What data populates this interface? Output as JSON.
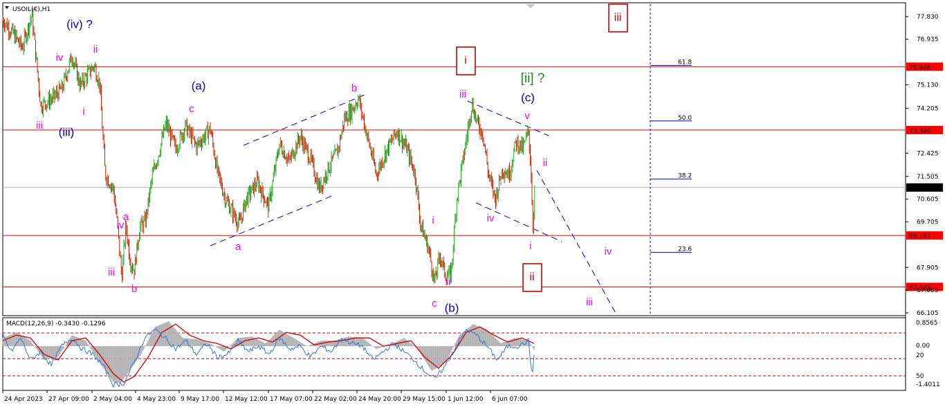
{
  "header": {
    "symbol_label": "USOIL(€),H1",
    "macd_label": "MACD(12,26,9) -0.3430 -0.1296"
  },
  "colors": {
    "bg": "#ffffff",
    "up_candle": "#22aa22",
    "down_candle": "#cc2200",
    "hline": "#ff0000",
    "fib": "#0000cc",
    "trend": "#0000cc",
    "wave_blue": "#0000cc",
    "wave_magenta": "#ff00ff",
    "wave_red": "#cc0000",
    "wave_green": "#228b22",
    "macd_hist": "#b0b0b0",
    "macd_signal": "#cc0000",
    "macd_line": "#1e6fd9"
  },
  "chart_data": {
    "type": "candlestick",
    "title": "USOIL(€),H1",
    "ylim": [
      66.105,
      78.0
    ],
    "y_ticks": [
      "77.830",
      "76.935",
      "75.130",
      "74.205",
      "72.425",
      "71.505",
      "70.605",
      "69.705",
      "67.905",
      "67.005",
      "66.105"
    ],
    "x_ticks": [
      "24 Apr 2023",
      "27 Apr 09:00",
      "2 May 04:00",
      "4 May 23:00",
      "9 May 17:00",
      "12 May 12:00",
      "17 May 07:00",
      "22 May 02:00",
      "24 May 20:00",
      "29 May 15:00",
      "1 Jun 12:00",
      "6 Jun 07:00"
    ],
    "price_levels": [
      {
        "value": 75.848,
        "label": "75.848"
      },
      {
        "value": 73.34,
        "label": "73.340"
      },
      {
        "value": 71.067,
        "label": "71.067"
      },
      {
        "value": 69.167,
        "label": "69.167"
      },
      {
        "value": 67.133,
        "label": "67.133"
      }
    ],
    "fib_levels": [
      {
        "label": "61.8",
        "value": 75.9
      },
      {
        "label": "50.0",
        "value": 73.7
      },
      {
        "label": "38.2",
        "value": 71.4
      },
      {
        "label": "23.6",
        "value": 68.5
      }
    ],
    "price_path": [
      [
        0,
        77.7
      ],
      [
        14,
        77.2
      ],
      [
        28,
        76.6
      ],
      [
        42,
        77.9
      ],
      [
        55,
        74.3
      ],
      [
        72,
        74.6
      ],
      [
        86,
        75.0
      ],
      [
        100,
        76.3
      ],
      [
        112,
        75.1
      ],
      [
        124,
        75.6
      ],
      [
        132,
        75.9
      ],
      [
        140,
        75.2
      ],
      [
        148,
        71.6
      ],
      [
        160,
        71.0
      ],
      [
        166,
        69.5
      ],
      [
        172,
        67.5
      ],
      [
        178,
        69.6
      ],
      [
        184,
        68.2
      ],
      [
        190,
        67.8
      ],
      [
        198,
        69.5
      ],
      [
        206,
        69.7
      ],
      [
        216,
        71.5
      ],
      [
        226,
        72.5
      ],
      [
        236,
        73.6
      ],
      [
        250,
        72.6
      ],
      [
        264,
        73.5
      ],
      [
        280,
        72.7
      ],
      [
        300,
        73.4
      ],
      [
        310,
        71.7
      ],
      [
        322,
        70.6
      ],
      [
        332,
        70.1
      ],
      [
        342,
        69.6
      ],
      [
        352,
        70.6
      ],
      [
        368,
        71.3
      ],
      [
        384,
        70.3
      ],
      [
        400,
        72.8
      ],
      [
        414,
        72.1
      ],
      [
        430,
        73.1
      ],
      [
        446,
        72.1
      ],
      [
        458,
        71.0
      ],
      [
        470,
        71.8
      ],
      [
        484,
        72.5
      ],
      [
        494,
        73.8
      ],
      [
        504,
        74.1
      ],
      [
        514,
        74.6
      ],
      [
        526,
        73.2
      ],
      [
        540,
        71.6
      ],
      [
        556,
        72.6
      ],
      [
        570,
        73.3
      ],
      [
        584,
        72.6
      ],
      [
        596,
        71.6
      ],
      [
        604,
        69.6
      ],
      [
        616,
        68.6
      ],
      [
        624,
        67.3
      ],
      [
        632,
        68.4
      ],
      [
        640,
        67.6
      ],
      [
        648,
        67.6
      ],
      [
        656,
        70.6
      ],
      [
        668,
        72.6
      ],
      [
        678,
        74.4
      ],
      [
        686,
        73.6
      ],
      [
        694,
        73.2
      ],
      [
        702,
        71.6
      ],
      [
        712,
        70.6
      ],
      [
        722,
        71.8
      ],
      [
        732,
        71.6
      ],
      [
        742,
        72.9
      ],
      [
        752,
        72.6
      ],
      [
        760,
        73.3
      ],
      [
        764,
        71.5
      ],
      [
        766,
        69.4
      ],
      [
        769,
        71.067
      ]
    ],
    "macd_histogram_path": [
      [
        0,
        0.3
      ],
      [
        20,
        0.5
      ],
      [
        40,
        0.2
      ],
      [
        60,
        -0.5
      ],
      [
        80,
        -0.4
      ],
      [
        100,
        0.4
      ],
      [
        120,
        0.2
      ],
      [
        140,
        -0.6
      ],
      [
        160,
        -1.3
      ],
      [
        170,
        -1.35
      ],
      [
        180,
        -1.0
      ],
      [
        200,
        -0.3
      ],
      [
        220,
        0.7
      ],
      [
        240,
        0.9
      ],
      [
        260,
        0.3
      ],
      [
        280,
        0.25
      ],
      [
        300,
        0.1
      ],
      [
        320,
        -0.2
      ],
      [
        340,
        0.3
      ],
      [
        360,
        0.35
      ],
      [
        380,
        0.1
      ],
      [
        400,
        0.6
      ],
      [
        420,
        0.3
      ],
      [
        440,
        0.0
      ],
      [
        460,
        0.2
      ],
      [
        480,
        0.2
      ],
      [
        500,
        0.35
      ],
      [
        520,
        0.3
      ],
      [
        540,
        -0.1
      ],
      [
        560,
        0.05
      ],
      [
        580,
        0.3
      ],
      [
        600,
        -0.1
      ],
      [
        620,
        -0.9
      ],
      [
        640,
        -0.6
      ],
      [
        660,
        0.4
      ],
      [
        680,
        0.8
      ],
      [
        700,
        0.6
      ],
      [
        720,
        0.1
      ],
      [
        740,
        0.3
      ],
      [
        760,
        0.2
      ],
      [
        768,
        -0.13
      ]
    ],
    "macd_signal_path": [
      [
        0,
        0.2
      ],
      [
        20,
        0.4
      ],
      [
        40,
        0.3
      ],
      [
        60,
        -0.3
      ],
      [
        80,
        -0.5
      ],
      [
        100,
        0.2
      ],
      [
        120,
        0.3
      ],
      [
        140,
        -0.3
      ],
      [
        160,
        -1.0
      ],
      [
        175,
        -1.3
      ],
      [
        190,
        -1.1
      ],
      [
        210,
        -0.4
      ],
      [
        230,
        0.5
      ],
      [
        250,
        0.8
      ],
      [
        270,
        0.4
      ],
      [
        290,
        0.2
      ],
      [
        310,
        0.1
      ],
      [
        330,
        -0.1
      ],
      [
        350,
        0.2
      ],
      [
        370,
        0.3
      ],
      [
        390,
        0.15
      ],
      [
        410,
        0.5
      ],
      [
        430,
        0.4
      ],
      [
        450,
        0.05
      ],
      [
        470,
        0.15
      ],
      [
        490,
        0.2
      ],
      [
        510,
        0.3
      ],
      [
        530,
        0.3
      ],
      [
        550,
        0.0
      ],
      [
        570,
        0.1
      ],
      [
        590,
        0.2
      ],
      [
        610,
        -0.4
      ],
      [
        630,
        -0.8
      ],
      [
        650,
        -0.3
      ],
      [
        670,
        0.5
      ],
      [
        690,
        0.7
      ],
      [
        710,
        0.4
      ],
      [
        730,
        0.15
      ],
      [
        750,
        0.3
      ],
      [
        768,
        0.1
      ]
    ],
    "macd_line_path": [
      [
        0,
        0.4
      ],
      [
        12,
        -0.2
      ],
      [
        26,
        0.3
      ],
      [
        40,
        -0.5
      ],
      [
        55,
        -0.2
      ],
      [
        70,
        -0.7
      ],
      [
        85,
        0.0
      ],
      [
        100,
        0.3
      ],
      [
        115,
        -0.1
      ],
      [
        130,
        -0.3
      ],
      [
        145,
        -0.7
      ],
      [
        160,
        -1.4
      ],
      [
        175,
        -1.35
      ],
      [
        190,
        -0.6
      ],
      [
        205,
        0.3
      ],
      [
        220,
        0.6
      ],
      [
        235,
        0.3
      ],
      [
        250,
        -0.1
      ],
      [
        265,
        0.2
      ],
      [
        280,
        -0.3
      ],
      [
        295,
        0.1
      ],
      [
        310,
        -0.4
      ],
      [
        325,
        -0.3
      ],
      [
        340,
        0.2
      ],
      [
        355,
        -0.2
      ],
      [
        370,
        0.0
      ],
      [
        385,
        -0.3
      ],
      [
        400,
        0.3
      ],
      [
        415,
        -0.1
      ],
      [
        430,
        0.0
      ],
      [
        445,
        -0.4
      ],
      [
        460,
        0.0
      ],
      [
        475,
        -0.2
      ],
      [
        490,
        0.3
      ],
      [
        505,
        0.1
      ],
      [
        520,
        0.0
      ],
      [
        535,
        -0.5
      ],
      [
        550,
        -0.2
      ],
      [
        565,
        0.1
      ],
      [
        580,
        -0.2
      ],
      [
        595,
        -0.5
      ],
      [
        610,
        -0.9
      ],
      [
        625,
        -1.2
      ],
      [
        640,
        -0.7
      ],
      [
        655,
        0.0
      ],
      [
        670,
        0.6
      ],
      [
        685,
        0.4
      ],
      [
        700,
        0.0
      ],
      [
        715,
        -0.5
      ],
      [
        730,
        0.0
      ],
      [
        745,
        0.0
      ],
      [
        760,
        0.2
      ],
      [
        765,
        -1.1
      ],
      [
        768,
        -0.34
      ]
    ],
    "macd_ylim": [
      -1.4011,
      0.8565
    ],
    "macd_ticks": [
      "0.8565",
      "0.00",
      "-1.4011"
    ],
    "macd_right_labels": [
      "20",
      "50"
    ],
    "wave_labels": [
      {
        "text": "(iv) ?",
        "color": "blue",
        "px": [
          115,
          36
        ],
        "size": 17
      },
      {
        "text": "iv",
        "color": "magenta",
        "px": [
          86,
          84
        ],
        "size": 15
      },
      {
        "text": "ii",
        "color": "magenta",
        "px": [
          138,
          72
        ],
        "size": 15
      },
      {
        "text": "i",
        "color": "magenta",
        "px": [
          121,
          162
        ],
        "size": 15
      },
      {
        "text": "iii",
        "color": "magenta",
        "px": [
          57,
          182
        ],
        "size": 15
      },
      {
        "text": "(iii)",
        "color": "blue",
        "px": [
          96,
          192
        ],
        "size": 17
      },
      {
        "text": "(a)",
        "color": "blue",
        "px": [
          287,
          125
        ],
        "size": 17
      },
      {
        "text": "c",
        "color": "magenta",
        "px": [
          277,
          158
        ],
        "size": 15
      },
      {
        "text": "a",
        "color": "magenta",
        "px": [
          182,
          314
        ],
        "size": 15
      },
      {
        "text": "iv",
        "color": "magenta",
        "px": [
          174,
          326
        ],
        "size": 15
      },
      {
        "text": "iii",
        "color": "magenta",
        "px": [
          161,
          394
        ],
        "size": 15
      },
      {
        "text": "b",
        "color": "magenta",
        "px": [
          194,
          418
        ],
        "size": 15
      },
      {
        "text": "a",
        "color": "magenta",
        "px": [
          344,
          357
        ],
        "size": 15
      },
      {
        "text": "b",
        "color": "magenta",
        "px": [
          512,
          128
        ],
        "size": 15
      },
      {
        "text": "i",
        "color": "magenta",
        "px": [
          626,
          319
        ],
        "size": 15
      },
      {
        "text": "ii",
        "color": "magenta",
        "px": [
          648,
          408
        ],
        "size": 15
      },
      {
        "text": "c",
        "color": "magenta",
        "px": [
          628,
          439
        ],
        "size": 15
      },
      {
        "text": "(b)",
        "color": "blue",
        "px": [
          653,
          446
        ],
        "size": 17
      },
      {
        "text": "iii",
        "color": "magenta",
        "px": [
          669,
          137
        ],
        "size": 15
      },
      {
        "text": "(c)",
        "color": "blue",
        "px": [
          763,
          142
        ],
        "size": 17
      },
      {
        "text": "v",
        "color": "magenta",
        "px": [
          762,
          168
        ],
        "size": 15
      },
      {
        "text": "[ii] ?",
        "color": "green",
        "px": [
          770,
          114
        ],
        "size": 19
      },
      {
        "text": "ii",
        "color": "magenta",
        "px": [
          788,
          236
        ],
        "size": 15
      },
      {
        "text": "iv",
        "color": "magenta",
        "px": [
          709,
          316
        ],
        "size": 15
      },
      {
        "text": "i",
        "color": "magenta",
        "px": [
          767,
          356
        ],
        "size": 15
      },
      {
        "text": "iv",
        "color": "magenta",
        "px": [
          879,
          364
        ],
        "size": 15
      },
      {
        "text": "iii",
        "color": "magenta",
        "px": [
          852,
          437
        ],
        "size": 15
      }
    ],
    "boxed_labels": [
      {
        "text": "iii",
        "px": [
          893,
          26
        ]
      },
      {
        "text": "i",
        "px": [
          673,
          88
        ]
      },
      {
        "text": "ii",
        "px": [
          769,
          401
        ]
      }
    ]
  }
}
